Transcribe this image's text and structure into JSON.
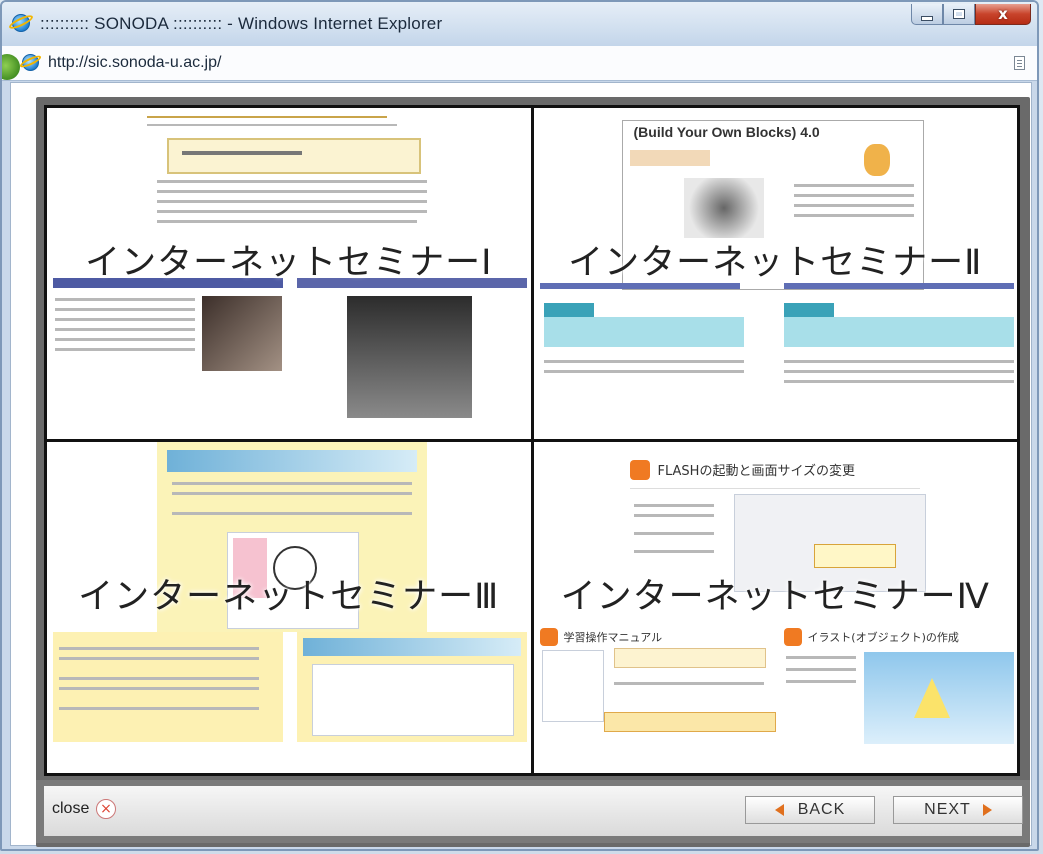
{
  "window": {
    "title": ":::::::::: SONODA :::::::::: - Windows Internet Explorer",
    "controls": {
      "minimize": "minimize",
      "maximize": "maximize",
      "close": "x"
    }
  },
  "address": {
    "url": "http://sic.sonoda-u.ac.jp/"
  },
  "gallery": {
    "cells": [
      {
        "label": "インターネットセミナーⅠ"
      },
      {
        "label": "インターネットセミナーⅡ"
      },
      {
        "label": "インターネットセミナーⅢ"
      },
      {
        "label": "インターネットセミナーⅣ"
      }
    ],
    "thumb_text": {
      "c2_title": "(Build Your Own Blocks) 4.0",
      "c4_title": "FLASHの起動と画面サイズの変更",
      "c4_bottom_left": "学習操作マニュアル",
      "c4_bottom_right": "イラスト(オブジェクト)の作成"
    }
  },
  "footer": {
    "close_label": "close",
    "back_label": "BACK",
    "next_label": "NEXT"
  },
  "colors": {
    "accent": "#e0701e",
    "title_bar": "#d3e1f0",
    "close_button": "#c8432b"
  }
}
